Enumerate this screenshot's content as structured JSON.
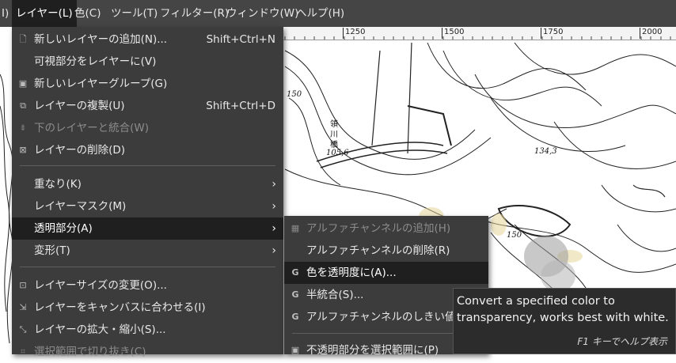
{
  "menubar": {
    "items": [
      {
        "label": "I)"
      },
      {
        "label": "レイヤー(L)"
      },
      {
        "label": "色(C)"
      },
      {
        "label": "ツール(T)"
      },
      {
        "label": "フィルター(R)"
      },
      {
        "label": "ウィンドウ(W)"
      },
      {
        "label": "ヘルプ(H)"
      }
    ]
  },
  "ruler": {
    "labels": [
      "1250",
      "1500",
      "1750",
      "2000"
    ]
  },
  "map_text": [
    "150",
    "105,6",
    "134,3",
    "150",
    "領",
    "川",
    "橋"
  ],
  "layer_menu": {
    "items": [
      {
        "icon": "new-layer-icon",
        "label": "新しいレイヤーの追加(N)...",
        "shortcut": "Shift+Ctrl+N"
      },
      {
        "icon": "",
        "label": "可視部分をレイヤーに(V)",
        "shortcut": ""
      },
      {
        "icon": "layer-group-icon",
        "label": "新しいレイヤーグループ(G)",
        "shortcut": ""
      },
      {
        "icon": "duplicate-layer-icon",
        "label": "レイヤーの複製(U)",
        "shortcut": "Shift+Ctrl+D"
      },
      {
        "icon": "merge-down-icon",
        "label": "下のレイヤーと統合(W)",
        "shortcut": ""
      },
      {
        "icon": "delete-layer-icon",
        "label": "レイヤーの削除(D)",
        "shortcut": ""
      },
      {
        "icon": "",
        "label": "重なり(K)",
        "shortcut": ""
      },
      {
        "icon": "",
        "label": "レイヤーマスク(M)",
        "shortcut": ""
      },
      {
        "icon": "",
        "label": "透明部分(A)",
        "shortcut": ""
      },
      {
        "icon": "",
        "label": "変形(T)",
        "shortcut": ""
      },
      {
        "icon": "resize-icon",
        "label": "レイヤーサイズの変更(O)...",
        "shortcut": ""
      },
      {
        "icon": "fit-canvas-icon",
        "label": "レイヤーをキャンバスに合わせる(I)",
        "shortcut": ""
      },
      {
        "icon": "scale-icon",
        "label": "レイヤーの拡大・縮小(S)...",
        "shortcut": ""
      },
      {
        "icon": "crop-icon",
        "label": "選択範囲で切り抜き(C)",
        "shortcut": ""
      }
    ]
  },
  "transparency_menu": {
    "items": [
      {
        "icon": "checker-icon",
        "label": "アルファチャンネルの追加(H)"
      },
      {
        "icon": "",
        "label": "アルファチャンネルの削除(R)"
      },
      {
        "icon": "gegl-icon",
        "label": "色を透明度に(A)..."
      },
      {
        "icon": "gegl-icon",
        "label": "半統合(S)..."
      },
      {
        "icon": "gegl-icon",
        "label": "アルファチャンネルのしきい値(T)..."
      },
      {
        "icon": "",
        "label": "不透明部分を選択範囲に(P)"
      }
    ]
  },
  "tooltip": {
    "text": "Convert a specified color to\ntransparency, works best with white.",
    "hint": "F1 キーでヘルプ表示"
  }
}
